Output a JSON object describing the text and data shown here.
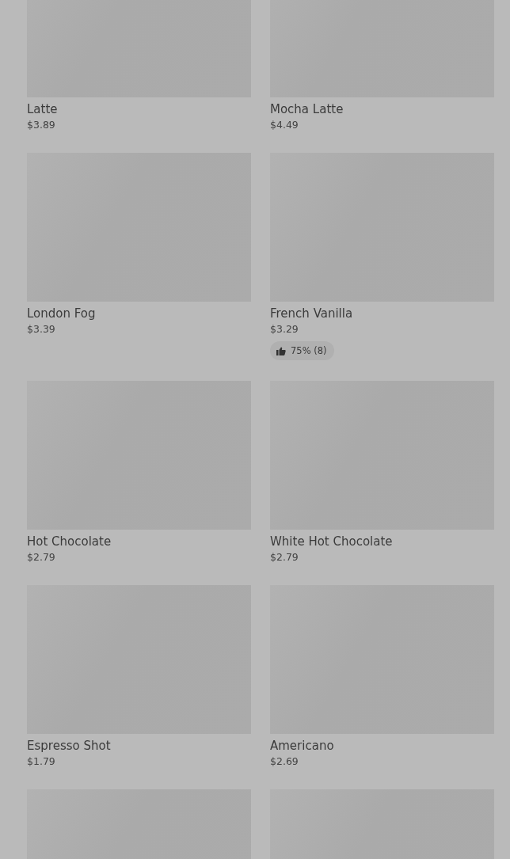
{
  "products": [
    {
      "kind": "full",
      "name": "Latte",
      "price": "$3.89"
    },
    {
      "kind": "full",
      "name": "Mocha Latte",
      "price": "$4.49"
    },
    {
      "kind": "full",
      "name": "London Fog",
      "price": "$3.39"
    },
    {
      "kind": "full",
      "name": "French Vanilla",
      "price": "$3.29",
      "rating": {
        "percent": "75%",
        "count": "(8)"
      }
    },
    {
      "kind": "full",
      "name": "Hot Chocolate",
      "price": "$2.79"
    },
    {
      "kind": "full",
      "name": "White Hot Chocolate",
      "price": "$2.79"
    },
    {
      "kind": "full",
      "name": "Espresso Shot",
      "price": "$1.79"
    },
    {
      "kind": "full",
      "name": "Americano",
      "price": "$2.69"
    },
    {
      "kind": "cut"
    },
    {
      "kind": "cut"
    }
  ]
}
